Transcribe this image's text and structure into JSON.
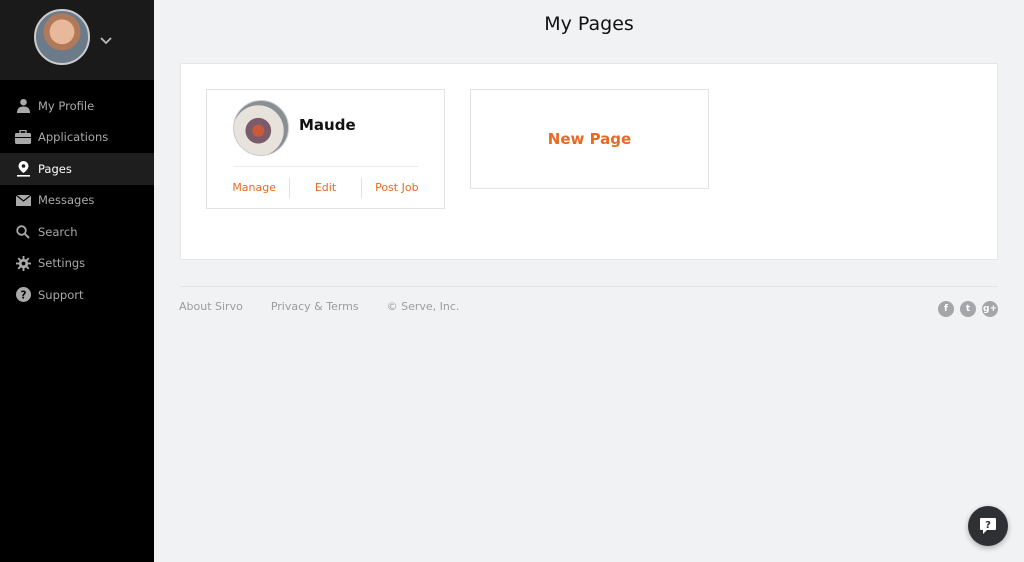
{
  "page": {
    "title": "My Pages"
  },
  "sidebar": {
    "items": [
      {
        "label": "My Profile",
        "icon": "user-icon"
      },
      {
        "label": "Applications",
        "icon": "briefcase-icon"
      },
      {
        "label": "Pages",
        "icon": "location-pin-icon",
        "active": true
      },
      {
        "label": "Messages",
        "icon": "envelope-icon"
      },
      {
        "label": "Search",
        "icon": "search-icon"
      },
      {
        "label": "Settings",
        "icon": "gear-icon"
      },
      {
        "label": "Support",
        "icon": "question-circle-icon"
      }
    ]
  },
  "cards": [
    {
      "name": "Maude",
      "actions": [
        "Manage",
        "Edit",
        "Post Job"
      ]
    }
  ],
  "new_page": {
    "label": "New Page"
  },
  "footer": {
    "links": [
      "About Sirvo",
      "Privacy & Terms",
      "© Serve, Inc."
    ],
    "social": [
      {
        "icon": "facebook-icon",
        "glyph": "f"
      },
      {
        "icon": "twitter-icon",
        "glyph": "t"
      },
      {
        "icon": "google-plus-icon",
        "glyph": "g+"
      }
    ]
  },
  "colors": {
    "accent": "#e86a23",
    "sidebar_bg": "#000000",
    "page_bg": "#f1f2f4"
  }
}
